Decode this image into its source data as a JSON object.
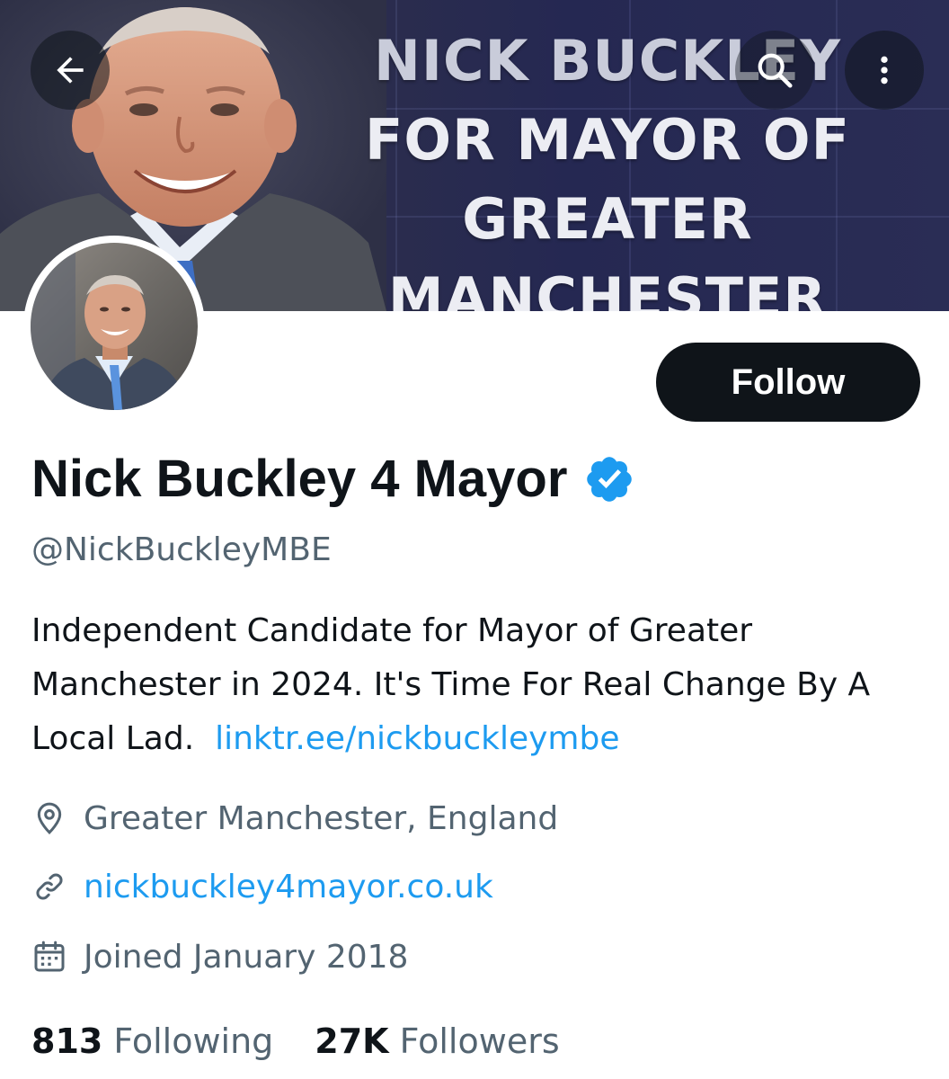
{
  "banner": {
    "title_lines": [
      "NICK BUCKLEY",
      "FOR MAYOR OF",
      "GREATER",
      "MANCHESTER"
    ],
    "portrait_icon": "candidate-photo"
  },
  "nav": {
    "back_icon": "arrow-left-icon",
    "search_icon": "search-icon",
    "more_icon": "more-vertical-icon"
  },
  "profile": {
    "name": "Nick Buckley 4 Mayor",
    "verified": true,
    "verified_color": "#1d9bf0",
    "handle": "@NickBuckleyMBE",
    "bio_text": "Independent Candidate for Mayor of Greater Manchester in 2024.  It's Time For Real Change By A Local Lad.",
    "bio_link": "linktr.ee/nickbuckleymbe",
    "location": "Greater Manchester, England",
    "website": "nickbuckley4mayor.co.uk",
    "joined": "Joined January 2018"
  },
  "actions": {
    "follow_label": "Follow"
  },
  "stats": {
    "following_count": "813",
    "following_label": "Following",
    "followers_count": "27K",
    "followers_label": "Followers"
  },
  "colors": {
    "accent": "#1d9bf0",
    "text": "#0f1419",
    "muted": "#536471",
    "button_bg": "#0f1419"
  }
}
